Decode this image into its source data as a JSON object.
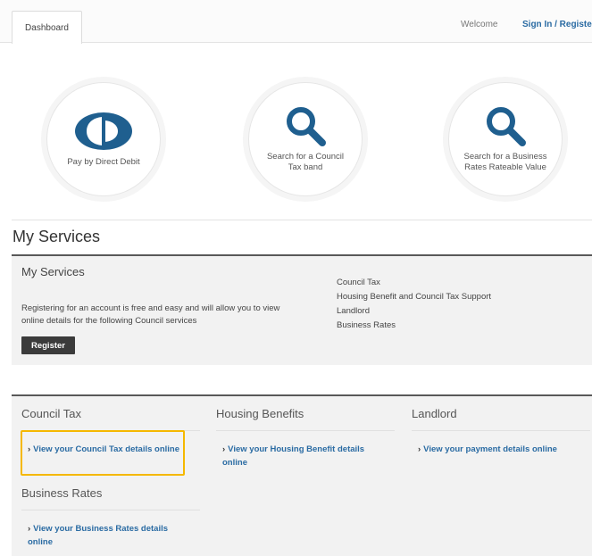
{
  "header": {
    "tab_label": "Dashboard",
    "welcome": "Welcome",
    "signin": "Sign In / Register"
  },
  "quick_links": [
    {
      "label": "Pay by Direct Debit",
      "icon": "direct-debit-icon"
    },
    {
      "label": "Search for a Council Tax band",
      "icon": "search-icon"
    },
    {
      "label": "Search for a Business Rates Rateable Value",
      "icon": "search-icon"
    }
  ],
  "section_title": "My Services",
  "services_panel": {
    "title": "My Services",
    "description": "Registering for an account is free and easy and will allow you to view online details for the following Council services",
    "register_label": "Register",
    "services": [
      "Council Tax",
      "Housing Benefit and Council Tax Support",
      "Landlord",
      "Business Rates"
    ]
  },
  "columns": [
    {
      "title": "Council Tax",
      "link": "View your Council Tax details online"
    },
    {
      "title": "Housing Benefits",
      "link": "View your Housing Benefit details online"
    },
    {
      "title": "Landlord",
      "link": "View your payment details online"
    },
    {
      "title": "Business Rates",
      "link": "View your Business Rates details online"
    }
  ],
  "colors": {
    "link": "#2a6ba3",
    "icon_blue": "#1f5f8f",
    "highlight": "#f5b800",
    "button": "#3b3b3b"
  }
}
